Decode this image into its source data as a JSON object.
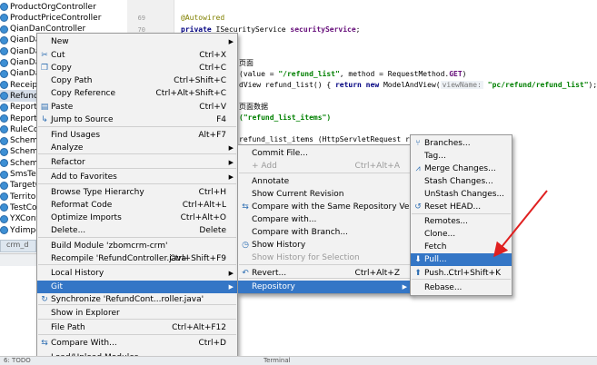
{
  "tree": {
    "items": [
      {
        "label": "ProductOrgController",
        "selected": false
      },
      {
        "label": "ProductPriceController",
        "selected": false
      },
      {
        "label": "QianDanController",
        "selected": false
      },
      {
        "label": "QianDan",
        "selected": false
      },
      {
        "label": "QianDan",
        "selected": false
      },
      {
        "label": "QianDan",
        "selected": false
      },
      {
        "label": "QianDan",
        "selected": false
      },
      {
        "label": "ReceiptC",
        "selected": false
      },
      {
        "label": "RefundC",
        "selected": true
      },
      {
        "label": "ReportA",
        "selected": false
      },
      {
        "label": "ReportC",
        "selected": false
      },
      {
        "label": "RuleCon",
        "selected": false
      },
      {
        "label": "Scheme",
        "selected": false
      },
      {
        "label": "Scheme",
        "selected": false
      },
      {
        "label": "Scheme",
        "selected": false
      },
      {
        "label": "SmsTem",
        "selected": false
      },
      {
        "label": "TargetC",
        "selected": false
      },
      {
        "label": "Territor",
        "selected": false
      },
      {
        "label": "TestCon",
        "selected": false
      },
      {
        "label": "YXContr",
        "selected": false
      },
      {
        "label": "Ydimpor",
        "selected": false
      }
    ],
    "tab_label": "crm_d"
  },
  "gutter": {
    "line_numbers": [
      "69",
      "70"
    ]
  },
  "editor": {
    "annotation": "@Autowired",
    "line2_kw": "private",
    "line2_type": " ISecurityService ",
    "line2_field": "securityService",
    "line2_end": ";",
    "comment1": "页面",
    "mapping_pre": "(value = ",
    "mapping_str": "\"/refund_list\"",
    "mapping_post": ", method = RequestMethod.",
    "mapping_get": "GET",
    "mapping_close": ")",
    "view_pre": "dView refund_list() { ",
    "view_return": "return new",
    "view_mid": " ModelAndView(",
    "view_hint": "viewName:",
    "view_str": " \"pc/refund/refund_list\"",
    "view_end": "); }",
    "comment2": "页面数据",
    "items_str": "(\"refund_list_items\")",
    "items_line": "refund_list_items (HttpServletRequest req) th"
  },
  "context_menu": {
    "items": [
      {
        "label": "New",
        "shortcut": "",
        "submenu": true,
        "icon": ""
      },
      {
        "label": "Cut",
        "shortcut": "Ctrl+X",
        "submenu": false,
        "icon": "scissors-icon"
      },
      {
        "label": "Copy",
        "shortcut": "Ctrl+C",
        "submenu": false,
        "icon": "copy-icon"
      },
      {
        "label": "Copy Path",
        "shortcut": "Ctrl+Shift+C",
        "submenu": false,
        "icon": ""
      },
      {
        "label": "Copy Reference",
        "shortcut": "Ctrl+Alt+Shift+C",
        "submenu": false,
        "icon": ""
      },
      {
        "label": "Paste",
        "shortcut": "Ctrl+V",
        "submenu": false,
        "icon": "paste-icon"
      },
      {
        "label": "Jump to Source",
        "shortcut": "F4",
        "submenu": false,
        "icon": "jump-icon"
      },
      {
        "label": "Find Usages",
        "shortcut": "Alt+F7",
        "submenu": false,
        "icon": ""
      },
      {
        "label": "Analyze",
        "shortcut": "",
        "submenu": true,
        "icon": ""
      },
      {
        "label": "Refactor",
        "shortcut": "",
        "submenu": true,
        "icon": ""
      },
      {
        "label": "Add to Favorites",
        "shortcut": "",
        "submenu": true,
        "icon": ""
      },
      {
        "label": "Browse Type Hierarchy",
        "shortcut": "Ctrl+H",
        "submenu": false,
        "icon": ""
      },
      {
        "label": "Reformat Code",
        "shortcut": "Ctrl+Alt+L",
        "submenu": false,
        "icon": ""
      },
      {
        "label": "Optimize Imports",
        "shortcut": "Ctrl+Alt+O",
        "submenu": false,
        "icon": ""
      },
      {
        "label": "Delete...",
        "shortcut": "Delete",
        "submenu": false,
        "icon": ""
      },
      {
        "label": "Build Module 'zbomcrm-crm'",
        "shortcut": "",
        "submenu": false,
        "icon": ""
      },
      {
        "label": "Recompile 'RefundController.java'",
        "shortcut": "Ctrl+Shift+F9",
        "submenu": false,
        "icon": ""
      },
      {
        "label": "Local History",
        "shortcut": "",
        "submenu": true,
        "icon": ""
      },
      {
        "label": "Git",
        "shortcut": "",
        "submenu": true,
        "icon": ""
      },
      {
        "label": "Synchronize 'RefundCont...roller.java'",
        "shortcut": "",
        "submenu": false,
        "icon": "sync-icon"
      },
      {
        "label": "Show in Explorer",
        "shortcut": "",
        "submenu": false,
        "icon": ""
      },
      {
        "label": "File Path",
        "shortcut": "Ctrl+Alt+F12",
        "submenu": false,
        "icon": ""
      },
      {
        "label": "Compare With...",
        "shortcut": "Ctrl+D",
        "submenu": false,
        "icon": "compare-icon"
      },
      {
        "label": "Load/Unload Modules...",
        "shortcut": "",
        "submenu": false,
        "icon": ""
      }
    ]
  },
  "git_menu": {
    "items": [
      {
        "label": "Commit File...",
        "shortcut": "",
        "submenu": false,
        "disabled": false,
        "icon": ""
      },
      {
        "label": "+ Add",
        "shortcut": "Ctrl+Alt+A",
        "submenu": false,
        "disabled": true,
        "icon": ""
      },
      {
        "label": "Annotate",
        "shortcut": "",
        "submenu": false,
        "disabled": false,
        "icon": ""
      },
      {
        "label": "Show Current Revision",
        "shortcut": "",
        "submenu": false,
        "disabled": false,
        "icon": ""
      },
      {
        "label": "Compare with the Same Repository Version",
        "shortcut": "",
        "submenu": false,
        "disabled": false,
        "icon": "compare-icon"
      },
      {
        "label": "Compare with...",
        "shortcut": "",
        "submenu": false,
        "disabled": false,
        "icon": ""
      },
      {
        "label": "Compare with Branch...",
        "shortcut": "",
        "submenu": false,
        "disabled": false,
        "icon": ""
      },
      {
        "label": "Show History",
        "shortcut": "",
        "submenu": false,
        "disabled": false,
        "icon": "history-icon"
      },
      {
        "label": "Show History for Selection",
        "shortcut": "",
        "submenu": false,
        "disabled": true,
        "icon": ""
      },
      {
        "label": "Revert...",
        "shortcut": "Ctrl+Alt+Z",
        "submenu": false,
        "disabled": false,
        "icon": "revert-icon"
      },
      {
        "label": "Repository",
        "shortcut": "",
        "submenu": true,
        "disabled": false,
        "icon": ""
      }
    ]
  },
  "repo_menu": {
    "items": [
      {
        "label": "Branches...",
        "shortcut": "",
        "icon": "branch-icon"
      },
      {
        "label": "Tag...",
        "shortcut": "",
        "icon": ""
      },
      {
        "label": "Merge Changes...",
        "shortcut": "",
        "icon": "merge-icon"
      },
      {
        "label": "Stash Changes...",
        "shortcut": "",
        "icon": ""
      },
      {
        "label": "UnStash Changes...",
        "shortcut": "",
        "icon": ""
      },
      {
        "label": "Reset HEAD...",
        "shortcut": "",
        "icon": "reset-icon"
      },
      {
        "label": "Remotes...",
        "shortcut": "",
        "icon": ""
      },
      {
        "label": "Clone...",
        "shortcut": "",
        "icon": ""
      },
      {
        "label": "Fetch",
        "shortcut": "",
        "icon": ""
      },
      {
        "label": "Pull...",
        "shortcut": "",
        "icon": "pull-icon"
      },
      {
        "label": "Push...",
        "shortcut": "Ctrl+Shift+K",
        "icon": "push-icon"
      },
      {
        "label": "Rebase...",
        "shortcut": "",
        "icon": ""
      }
    ]
  },
  "bottom_bar": {
    "left": "6: TODO",
    "right": "Terminal"
  },
  "colors": {
    "accent": "#3476c6",
    "annotation_arrow": "#e02020"
  }
}
